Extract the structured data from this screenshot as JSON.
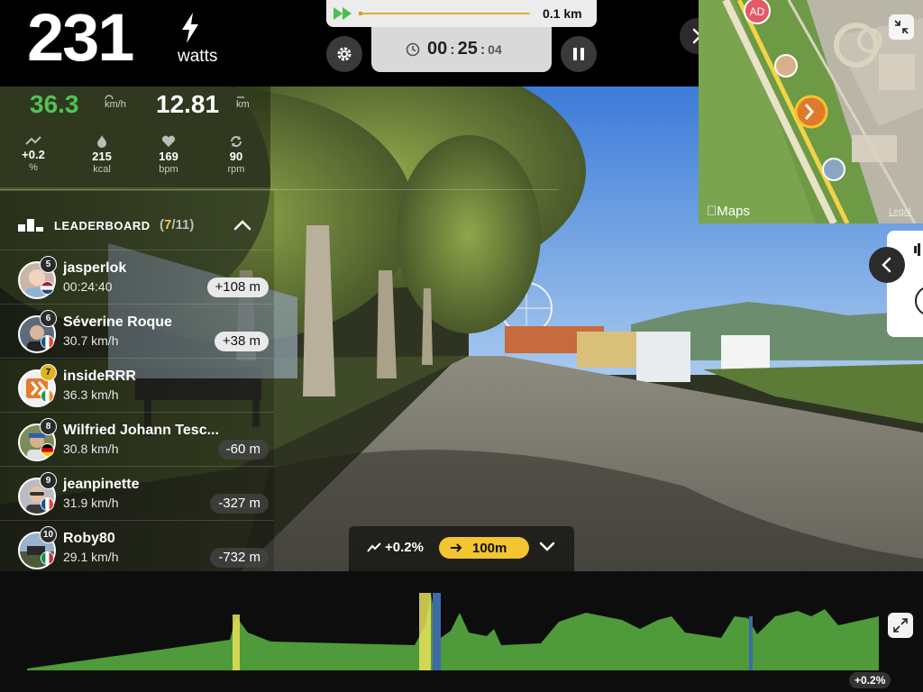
{
  "power": {
    "value": "231",
    "unit": "watts"
  },
  "course": {
    "distance": "0.1 km",
    "progress": 0.02
  },
  "timer": {
    "hours": "00",
    "minutes": "25",
    "seconds": "04"
  },
  "speed": {
    "value": "36.3",
    "unit": "km/h"
  },
  "distance": {
    "value": "12.81",
    "unit": "km"
  },
  "metrics": [
    {
      "icon": "grade-icon",
      "value": "+0.2",
      "unit": "%"
    },
    {
      "icon": "flame-icon",
      "value": "215",
      "unit": "kcal"
    },
    {
      "icon": "heart-icon",
      "value": "169",
      "unit": "bpm"
    },
    {
      "icon": "cadence-icon",
      "value": "90",
      "unit": "rpm"
    }
  ],
  "leaderboard": {
    "title": "LEADERBOARD",
    "position": "7",
    "total": "/11",
    "riders": [
      {
        "rank": "5",
        "name": "jasperlok",
        "detail": "00:24:40",
        "gap": "+108 m",
        "ahead": true,
        "flag": "nl"
      },
      {
        "rank": "6",
        "name": "Séverine Roque",
        "detail": "30.7 km/h",
        "gap": "+38 m",
        "ahead": true,
        "flag": "fr"
      },
      {
        "rank": "7",
        "name": "insideRRR",
        "detail": "36.3 km/h",
        "gap": "",
        "ahead": false,
        "flag": "ie"
      },
      {
        "rank": "8",
        "name": "Wilfried Johann Tesc...",
        "detail": "30.8 km/h",
        "gap": "-60 m",
        "ahead": false,
        "flag": "de"
      },
      {
        "rank": "9",
        "name": "jeanpinette",
        "detail": "31.9 km/h",
        "gap": "-327 m",
        "ahead": false,
        "flag": "fr"
      },
      {
        "rank": "10",
        "name": "Roby80",
        "detail": "29.1 km/h",
        "gap": "-732 m",
        "ahead": false,
        "flag": "it"
      }
    ]
  },
  "map": {
    "watermark": "Maps",
    "legal": "Legal",
    "marker_label": "AD"
  },
  "grade_bar": {
    "grade": "+0.2%",
    "distance": "100m"
  },
  "profile": {
    "current_grade": "+0.2%"
  },
  "colors": {
    "accent_green": "#52c255",
    "accent_yellow": "#f2c531",
    "profile_green": "#4f9a3a"
  }
}
